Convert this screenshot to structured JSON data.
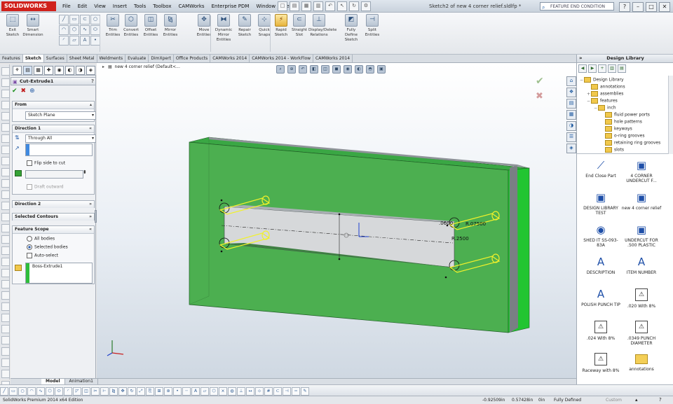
{
  "app": {
    "logo_text": "SOLIDWORKS",
    "document_title": "Sketch2 of new 4 corner relief.sldlfp *",
    "search_placeholder": "FEATURE END CONDITION",
    "menus": [
      "File",
      "Edit",
      "View",
      "Insert",
      "Tools",
      "Toolbox",
      "CAMWorks",
      "Enterprise PDM",
      "Window",
      "Help"
    ]
  },
  "command_manager": {
    "buttons": [
      {
        "label": "Exit Sketch",
        "icon": "exit-sketch-icon",
        "glyph": "⬚"
      },
      {
        "label": "Smart Dimension",
        "icon": "smart-dimension-icon",
        "glyph": "↔"
      },
      {
        "label": "Trim Entities",
        "icon": "trim-icon",
        "glyph": "✂"
      },
      {
        "label": "Convert Entities",
        "icon": "convert-icon",
        "glyph": "⬡"
      },
      {
        "label": "Offset Entities",
        "icon": "offset-icon",
        "glyph": "◫"
      },
      {
        "label": "Mirror Entities",
        "icon": "mirror-icon",
        "glyph": "⧎"
      },
      {
        "label": "Move Entities",
        "icon": "move-icon",
        "glyph": "✥"
      },
      {
        "label": "Dynamic Mirror Entities",
        "icon": "dynamic-mirror-icon",
        "glyph": "⧓"
      },
      {
        "label": "Repair Sketch",
        "icon": "repair-icon",
        "glyph": "✎"
      },
      {
        "label": "Quick Snaps",
        "icon": "snap-icon",
        "glyph": "⊹"
      },
      {
        "label": "Rapid Sketch",
        "icon": "rapid-sketch-icon",
        "glyph": "⚡"
      },
      {
        "label": "Straight Slot",
        "icon": "slot-icon",
        "glyph": "⊂"
      },
      {
        "label": "Display/Delete Relations",
        "icon": "relations-icon",
        "glyph": "⊥"
      },
      {
        "label": "Fully Define Sketch",
        "icon": "fully-define-icon",
        "glyph": "◩"
      },
      {
        "label": "Split Entities",
        "icon": "split-icon",
        "glyph": "⊣"
      }
    ],
    "tabs": [
      "Features",
      "Sketch",
      "Surfaces",
      "Sheet Metal",
      "Weldments",
      "Evaluate",
      "DimXpert",
      "Office Products",
      "CAMWorks 2014",
      "CAMWorks 2014 - WorkFlow",
      "CAMWorks 2014"
    ],
    "active_tab": "Sketch"
  },
  "property_manager": {
    "title": "Cut-Extrude1",
    "help_glyph": "?",
    "from": {
      "header": "From",
      "value": "Sketch Plane"
    },
    "direction1": {
      "header": "Direction 1",
      "end_condition": "Through All",
      "flip_side": "Flip side to cut",
      "draft": "Draft outward"
    },
    "direction2": {
      "header": "Direction 2"
    },
    "selected_contours": {
      "header": "Selected Contours"
    },
    "feature_scope": {
      "header": "Feature Scope",
      "options": [
        "All bodies",
        "Selected bodies",
        "Auto-select"
      ],
      "selected_option": "Selected bodies",
      "body_item": "Boss-Extrude1"
    }
  },
  "graphics": {
    "tree_root": "new 4 corner relief  (Default<...",
    "dimensions": [
      ".0600",
      "R.07500",
      "R.2500"
    ]
  },
  "bottom_tabs": [
    "Model",
    "Animation1"
  ],
  "active_bottom_tab": "Model",
  "status": {
    "edition": "SolidWorks Premium 2014 x64 Edition",
    "x": "-0.92509in",
    "y": "0.57428in",
    "z": "0in",
    "state": "Fully Defined",
    "custom": "Custom"
  },
  "design_library": {
    "title": "Design Library",
    "tree": [
      {
        "label": "Design Library",
        "depth": 0,
        "sign": "−"
      },
      {
        "label": "annotations",
        "depth": 1,
        "sign": ""
      },
      {
        "label": "assemblies",
        "depth": 1,
        "sign": "+"
      },
      {
        "label": "features",
        "depth": 1,
        "sign": "−"
      },
      {
        "label": "inch",
        "depth": 2,
        "sign": "−"
      },
      {
        "label": "fluid power ports",
        "depth": 3,
        "sign": ""
      },
      {
        "label": "hole patterns",
        "depth": 3,
        "sign": ""
      },
      {
        "label": "keyways",
        "depth": 3,
        "sign": ""
      },
      {
        "label": "o-ring grooves",
        "depth": 3,
        "sign": ""
      },
      {
        "label": "retaining ring grooves",
        "depth": 3,
        "sign": ""
      },
      {
        "label": "slots",
        "depth": 3,
        "sign": ""
      }
    ],
    "items": [
      {
        "label": "End Close Part",
        "kind": "glyph",
        "glyph": "⟋"
      },
      {
        "label": "4 CORNER UNDERCUT F...",
        "kind": "glyph",
        "glyph": "▣"
      },
      {
        "label": "DESIGN LIBRARY TEST",
        "kind": "glyph",
        "glyph": "▣"
      },
      {
        "label": "new 4 corner relief",
        "kind": "glyph",
        "glyph": "▣"
      },
      {
        "label": "SHED IT SS-093-83A",
        "kind": "glyph",
        "glyph": "◉"
      },
      {
        "label": "UNDERCUT FOR .500 PLASTIC",
        "kind": "glyph",
        "glyph": "▣"
      },
      {
        "label": "DESCRIPTION",
        "kind": "glyph",
        "glyph": "A"
      },
      {
        "label": "ITEM NUMBER",
        "kind": "glyph",
        "glyph": "A"
      },
      {
        "label": "POLISH PUNCH TIP",
        "kind": "glyph",
        "glyph": "A"
      },
      {
        "label": ".020 With 8%",
        "kind": "box",
        "glyph": "⚠"
      },
      {
        "label": ".024 With 8%",
        "kind": "box",
        "glyph": "⚠"
      },
      {
        "label": ".0349 PUNCH DIAMETER",
        "kind": "box",
        "glyph": "⚠"
      },
      {
        "label": "Raceway with 8%",
        "kind": "box",
        "glyph": "⚠"
      },
      {
        "label": "annotations",
        "kind": "folder",
        "glyph": ""
      }
    ]
  },
  "colors": {
    "part_face": "#4caf50",
    "part_side": "#22c531",
    "part_edge_dark": "#7a7f84",
    "sketch_yellow": "#f1f12a",
    "brand_red": "#d0211c"
  }
}
